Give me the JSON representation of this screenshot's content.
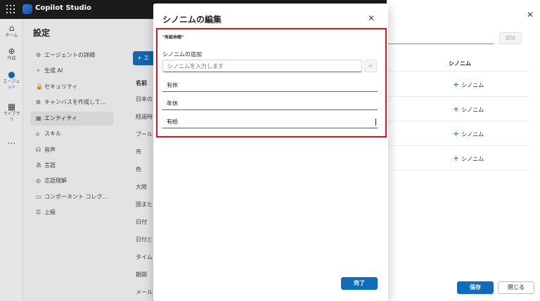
{
  "app": {
    "title": "Copilot Studio"
  },
  "rail": [
    {
      "icon": "⌂",
      "label": "ホーム"
    },
    {
      "icon": "⊕",
      "label": "作成"
    },
    {
      "icon": "●",
      "label": "エージェント"
    },
    {
      "icon": "▦",
      "label": "ライブラリ"
    },
    {
      "icon": "⋯",
      "label": ""
    }
  ],
  "settings": {
    "title": "設定",
    "nav": [
      {
        "icon": "⚙",
        "label": "エージェントの詳細"
      },
      {
        "icon": "✧",
        "label": "生成 AI"
      },
      {
        "icon": "🔒",
        "label": "セキュリティ"
      },
      {
        "icon": "⊞",
        "label": "キャンバスを作成して..."
      },
      {
        "icon": "▦",
        "label": "エンティティ"
      },
      {
        "icon": "⌂",
        "label": "スキル"
      },
      {
        "icon": "☊",
        "label": "音声"
      },
      {
        "icon": "あ",
        "label": "言語"
      },
      {
        "icon": "◎",
        "label": "言語理解"
      },
      {
        "icon": "▭",
        "label": "コンポーネント コレク..."
      },
      {
        "icon": "☰",
        "label": "上級"
      }
    ],
    "new_entity_label": "+ エ",
    "column_name": "名前",
    "entity_rows": [
      "日本の",
      "経過時",
      "ブール",
      "市",
      "色",
      "大陸",
      "国また",
      "日付",
      "日付と",
      "タイム",
      "期間",
      "メール"
    ]
  },
  "side_panel": {
    "add_button": "追加",
    "column_synonym": "シノニム",
    "synonym_link": "シノニム",
    "save": "保存",
    "close": "閉じる"
  },
  "dialog": {
    "title": "シノニムの編集",
    "entity_name": "\"有給休暇\"",
    "add_label": "シノニムの追加",
    "input_placeholder": "シノニムを入力します",
    "synonyms": [
      "有休",
      "年休",
      "有給"
    ],
    "done": "完了"
  }
}
